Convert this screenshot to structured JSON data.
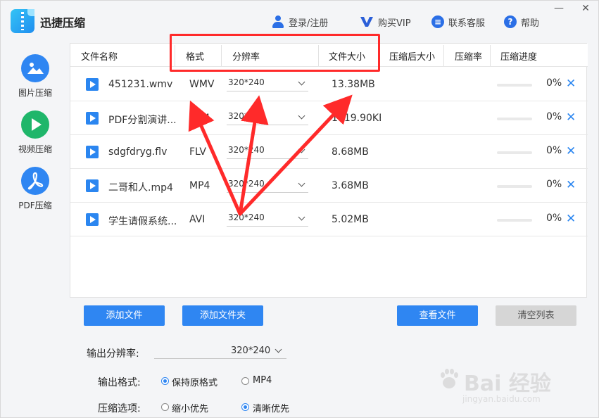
{
  "app": {
    "title": "迅捷压缩",
    "login": "登录/注册",
    "buy_vip": "购买VIP",
    "support": "联系客服",
    "help": "帮助",
    "minimize": "—",
    "close": "✕",
    "accent": "#2f86f2"
  },
  "sidebar": {
    "items": [
      {
        "label": "图片压缩",
        "icon": "image-icon"
      },
      {
        "label": "视频压缩",
        "icon": "play-icon",
        "active": true
      },
      {
        "label": "PDF压缩",
        "icon": "pdf-icon"
      }
    ]
  },
  "table": {
    "columns": [
      "文件名称",
      "格式",
      "分辨率",
      "文件大小",
      "压缩后大小",
      "压缩率",
      "压缩进度"
    ],
    "rows": [
      {
        "name": "451231.wmv",
        "format": "WMV",
        "resolution": "320*240",
        "size": "13.38MB",
        "progress": "0%"
      },
      {
        "name": "PDF分割演讲...",
        "format": "MP4",
        "resolution": "320*240",
        "size": "1019.90KB",
        "progress": "0%"
      },
      {
        "name": "sdgfdryg.flv",
        "format": "FLV",
        "resolution": "320*240",
        "size": "8.68MB",
        "progress": "0%"
      },
      {
        "name": "二哥和人.mp4",
        "format": "MP4",
        "resolution": "320*240",
        "size": "3.68MB",
        "progress": "0%"
      },
      {
        "name": "学生请假系统...",
        "format": "AVI",
        "resolution": "320*240",
        "size": "5.02MB",
        "progress": "0%"
      }
    ]
  },
  "buttons": {
    "add_file": "添加文件",
    "add_folder": "添加文件夹",
    "view_files": "查看文件",
    "clear_list": "清空列表"
  },
  "options": {
    "output_resolution_label": "输出分辨率:",
    "output_resolution_value": "320*240",
    "output_format_label": "输出格式:",
    "format_keep": "保持原格式",
    "format_mp4": "MP4",
    "compress_label": "压缩选项:",
    "compress_small": "缩小优先",
    "compress_clear": "清晰优先"
  },
  "watermark": {
    "brand": "Bai 经验",
    "url": "jingyan.baidu.com"
  },
  "annotation_color": "#ff2a2a"
}
